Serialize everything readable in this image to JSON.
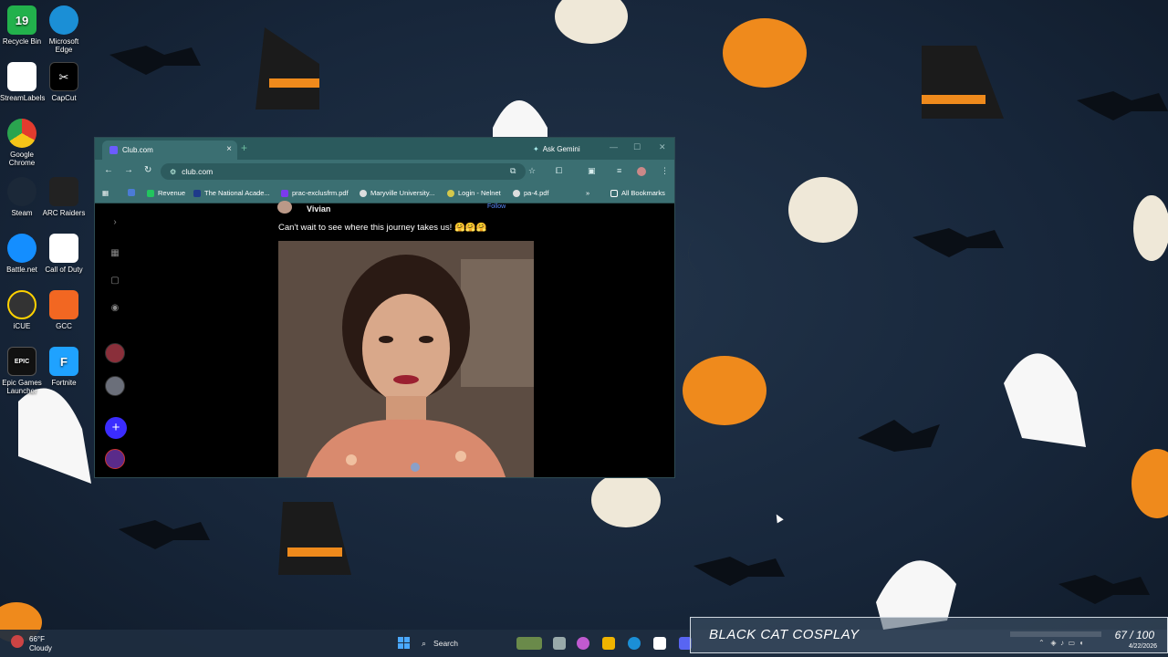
{
  "desktop": {
    "notification_count": "19",
    "icons": [
      {
        "label": "Recycle Bin",
        "icon": "recycle-bin-icon",
        "color": "#22b14c"
      },
      {
        "label": "Microsoft Edge",
        "icon": "edge-icon",
        "color": "#1b8fd6"
      },
      {
        "label": "StreamLabels",
        "icon": "streamlabels-icon",
        "color": "#ffffff"
      },
      {
        "label": "CapCut",
        "icon": "capcut-icon",
        "color": "#000000"
      },
      {
        "label": "Google Chrome",
        "icon": "chrome-icon",
        "color": "#e33b2e"
      },
      {
        "label": "Steam",
        "icon": "steam-icon",
        "color": "#1b2838"
      },
      {
        "label": "ARC Raiders",
        "icon": "arc-raiders-icon",
        "color": "#222222"
      },
      {
        "label": "Battle.net",
        "icon": "battlenet-icon",
        "color": "#148eff"
      },
      {
        "label": "Call of Duty",
        "icon": "call-of-duty-icon",
        "color": "#ffffff"
      },
      {
        "label": "iCUE",
        "icon": "icue-icon",
        "color": "#333333"
      },
      {
        "label": "GCC",
        "icon": "gcc-icon",
        "color": "#f26722"
      },
      {
        "label": "Epic Games Launcher",
        "icon": "epic-games-icon",
        "color": "#111111"
      },
      {
        "label": "Fortnite",
        "icon": "fortnite-icon",
        "color": "#1fa2ff"
      }
    ]
  },
  "browser": {
    "tab_title": "Club.com",
    "ask_gemini": "Ask Gemini",
    "url": "club.com",
    "bookmarks": [
      "Revenue",
      "The National Acade...",
      "prac-exclusfrm.pdf",
      "Maryville University...",
      "Login - Nelnet",
      "pa-4.pdf"
    ],
    "all_bookmarks": "All Bookmarks"
  },
  "post": {
    "author": "Vivian",
    "follow": "Follow",
    "caption": "Can't wait to see where this journey takes us! 🤗🤗🤗"
  },
  "taskbar": {
    "temperature": "66°F",
    "condition": "Cloudy",
    "search_placeholder": "Search",
    "date": "4/22/2026"
  },
  "overlay": {
    "title": "BLACK CAT COSPLAY",
    "count": "67 / 100"
  }
}
